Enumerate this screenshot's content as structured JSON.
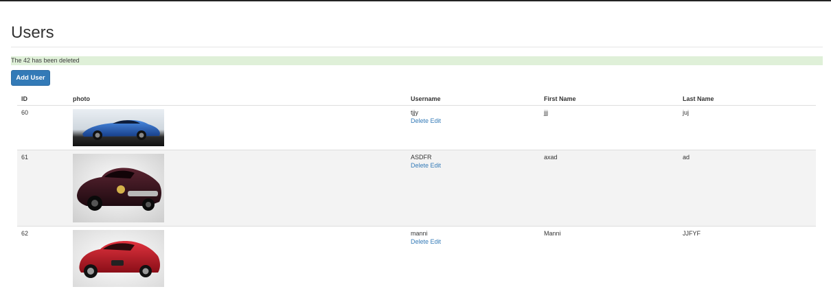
{
  "page": {
    "title": "Users"
  },
  "alert": {
    "message": "The 42 has been deleted"
  },
  "toolbar": {
    "add_user_label": "Add User"
  },
  "table": {
    "headers": {
      "id": "ID",
      "photo": "photo",
      "username": "Username",
      "first_name": "First Name",
      "last_name": "Last Name"
    },
    "rows": [
      {
        "id": "60",
        "photo": "blue sports car",
        "username": "tjjy",
        "first_name": "jjj",
        "last_name": "juj",
        "delete": "Delete",
        "edit": "Edit"
      },
      {
        "id": "61",
        "photo": "dark red classic car",
        "username": "ASDFR",
        "first_name": "axad",
        "last_name": "ad",
        "delete": "Delete",
        "edit": "Edit"
      },
      {
        "id": "62",
        "photo": "red jaguar sedan",
        "username": "manni",
        "first_name": "Manni",
        "last_name": "JJFYF",
        "delete": "Delete",
        "edit": "Edit"
      }
    ]
  },
  "colors": {
    "primary": "#337ab7",
    "alert_bg": "#dff0d8",
    "stripe": "#f3f3f3"
  }
}
